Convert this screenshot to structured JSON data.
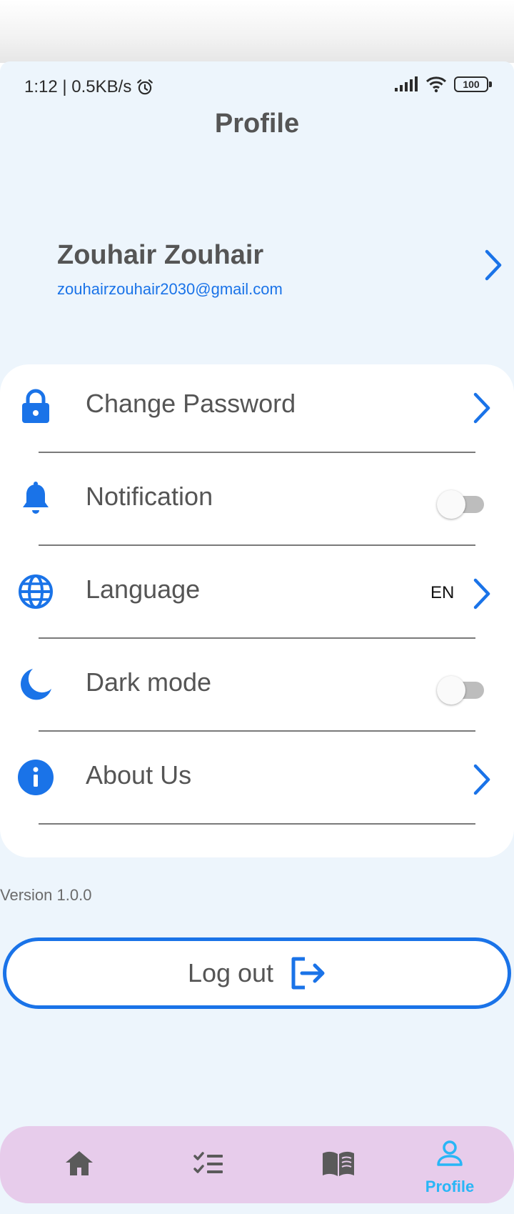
{
  "status_bar": {
    "time_speed": "1:12 | 0.5KB/s",
    "battery": "100",
    "icons": [
      "alarm-icon",
      "signal-icon",
      "wifi-icon",
      "battery-icon"
    ]
  },
  "header": {
    "title": "Profile"
  },
  "profile": {
    "name": "Zouhair Zouhair",
    "email": "zouhairzouhair2030@gmail.com"
  },
  "settings": {
    "items": [
      {
        "label": "Change Password",
        "icon": "lock-icon",
        "control": "chevron"
      },
      {
        "label": "Notification",
        "icon": "bell-icon",
        "control": "toggle",
        "on": false
      },
      {
        "label": "Language",
        "icon": "globe-icon",
        "control": "chevron",
        "value": "EN"
      },
      {
        "label": "Dark mode",
        "icon": "moon-icon",
        "control": "toggle",
        "on": false
      },
      {
        "label": "About Us",
        "icon": "info-icon",
        "control": "chevron"
      }
    ]
  },
  "footer": {
    "version": "Version 1.0.0",
    "logout_label": "Log out"
  },
  "bottom_nav": {
    "items": [
      {
        "icon": "home-icon",
        "active": false
      },
      {
        "icon": "checklist-icon",
        "active": false
      },
      {
        "icon": "book-icon",
        "active": false
      },
      {
        "icon": "person-icon",
        "label": "Profile",
        "active": true
      }
    ]
  },
  "colors": {
    "accent": "#1a73e8",
    "background": "#edf5fc",
    "nav_background": "#e7cceb",
    "nav_active": "#29b6f6",
    "text": "#555555"
  }
}
